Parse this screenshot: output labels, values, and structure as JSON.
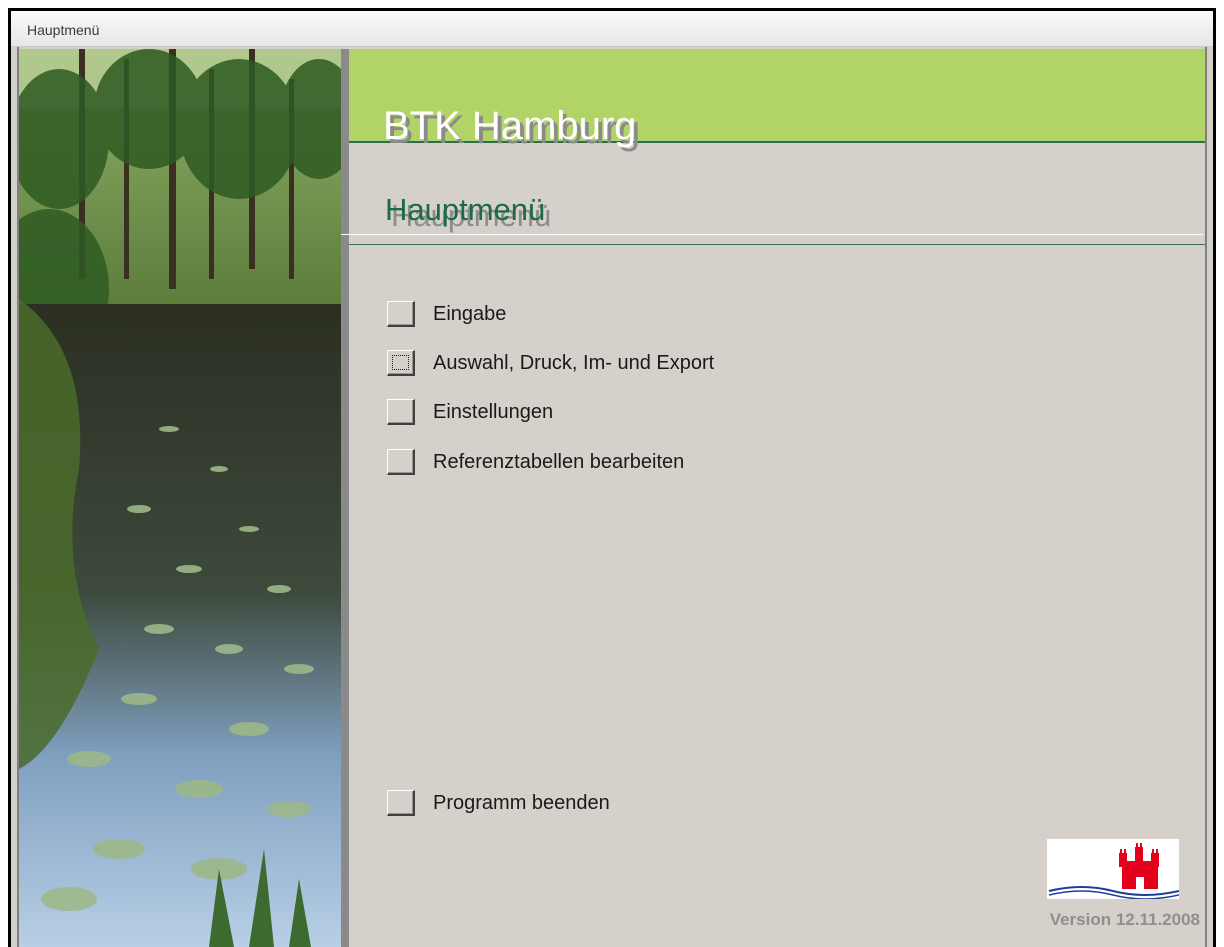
{
  "window": {
    "title": "Hauptmenü"
  },
  "header": {
    "app_title": "BTK Hamburg",
    "subtitle": "Hauptmenü"
  },
  "menu": [
    {
      "label": "Eingabe",
      "focused": false
    },
    {
      "label": "Auswahl, Druck, Im- und Export",
      "focused": true
    },
    {
      "label": "Einstellungen",
      "focused": false
    },
    {
      "label": "Referenztabellen bearbeiten",
      "focused": false
    }
  ],
  "exit_button": {
    "label": "Programm beenden"
  },
  "footer": {
    "version": "Version 12.11.2008"
  },
  "colors": {
    "header_band": "#b2d466",
    "subtitle_green": "#1d6b45",
    "background": "#d5d0ca",
    "hamburg_red": "#e2001a"
  },
  "icons": {
    "logo": "hamburg-castle-logo",
    "side_image": "forest-lake-photo"
  }
}
